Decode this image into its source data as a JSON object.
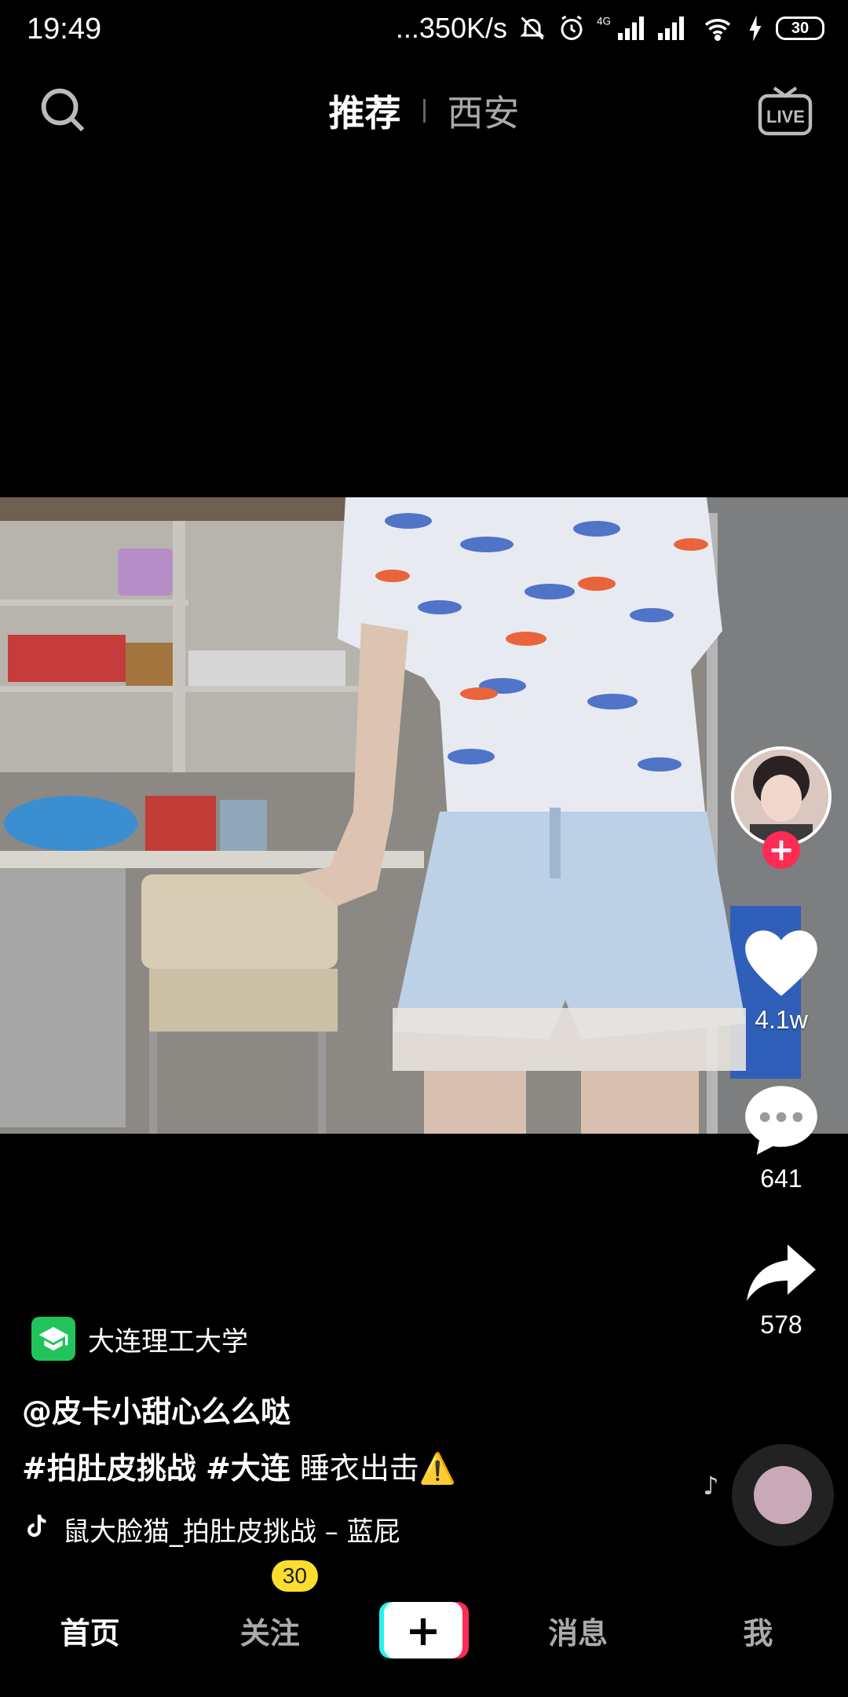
{
  "status_bar": {
    "time": "19:49",
    "speed": "...350K/s",
    "network": "4G",
    "battery": "30"
  },
  "top_nav": {
    "tabs": [
      {
        "label": "推荐",
        "active": true
      },
      {
        "label": "西安",
        "active": false
      }
    ],
    "live_label": "LIVE"
  },
  "side_actions": {
    "likes": "4.1w",
    "comments": "641",
    "shares": "578"
  },
  "caption": {
    "school": "大连理工大学",
    "author": "@皮卡小甜心么么哒",
    "hashtag_1": "#拍肚皮挑战",
    "hashtag_2": "#大连",
    "text": "睡衣出击⚠️",
    "music": "鼠大脸猫_拍肚皮挑战 – 蓝屁"
  },
  "bottom_nav": {
    "home": "首页",
    "follow": "关注",
    "follow_badge": "30",
    "create": "+",
    "messages": "消息",
    "me": "我"
  },
  "colors": {
    "accent_red": "#fe2c55",
    "accent_cyan": "#25f4ee",
    "badge_yellow": "#fadd2f",
    "school_green": "#21c45b"
  }
}
